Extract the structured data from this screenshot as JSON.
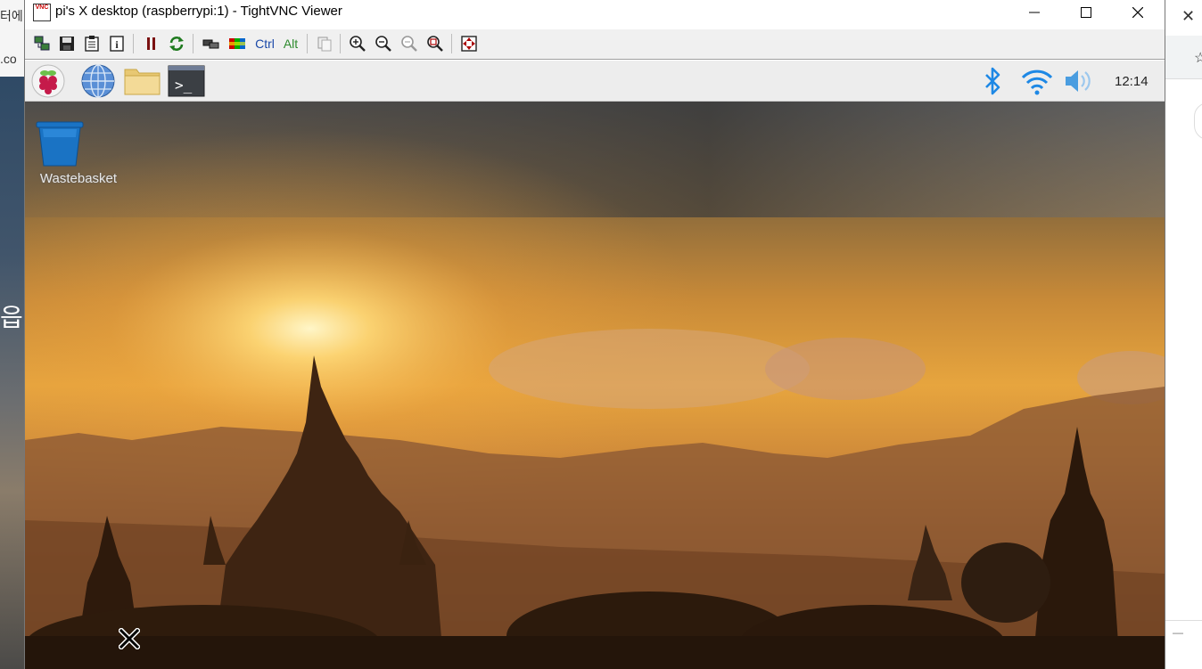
{
  "background": {
    "left_korean_text": "터에",
    "left_url_text": ".co",
    "left_big_glyph": "읍",
    "right_close_glyph": "✕",
    "right_star_glyph": "☆",
    "right_dash": "—"
  },
  "window": {
    "title": "pi's X desktop (raspberrypi:1) - TightVNC Viewer",
    "app_icon_text": "VNC",
    "controls": {
      "minimize_icon": "minimize-icon",
      "maximize_icon": "maximize-icon",
      "close_icon": "close-icon"
    }
  },
  "toolbar": {
    "ctrl_label": "Ctrl",
    "alt_label": "Alt",
    "buttons": [
      "new-connection-icon",
      "save-icon",
      "options-icon",
      "connection-info-icon",
      "pause-icon",
      "refresh-icon",
      "ctrl-alt-del-icon",
      "ctrl-esc-icon",
      "ctrl-toggle",
      "alt-toggle",
      "transfer-clipboard-icon",
      "zoom-in-icon",
      "zoom-out-icon",
      "zoom-100-icon",
      "zoom-auto-icon",
      "fullscreen-icon"
    ]
  },
  "remote": {
    "panel": {
      "launchers": [
        "raspberry-menu-icon",
        "web-browser-icon",
        "file-manager-icon",
        "terminal-icon"
      ],
      "terminal_prompt": ">_",
      "tray": [
        "bluetooth-icon",
        "wifi-icon",
        "volume-icon"
      ],
      "clock": "12:14"
    },
    "desktop": {
      "wastebasket_label": "Wastebasket"
    }
  },
  "colors": {
    "bluetooth": "#1e88e5",
    "wifi": "#1e88e5",
    "volume": "#4a9de0",
    "wastebasket": "#1a73c4",
    "raspberry": "#c51a4a",
    "leaf": "#6cc04a"
  }
}
